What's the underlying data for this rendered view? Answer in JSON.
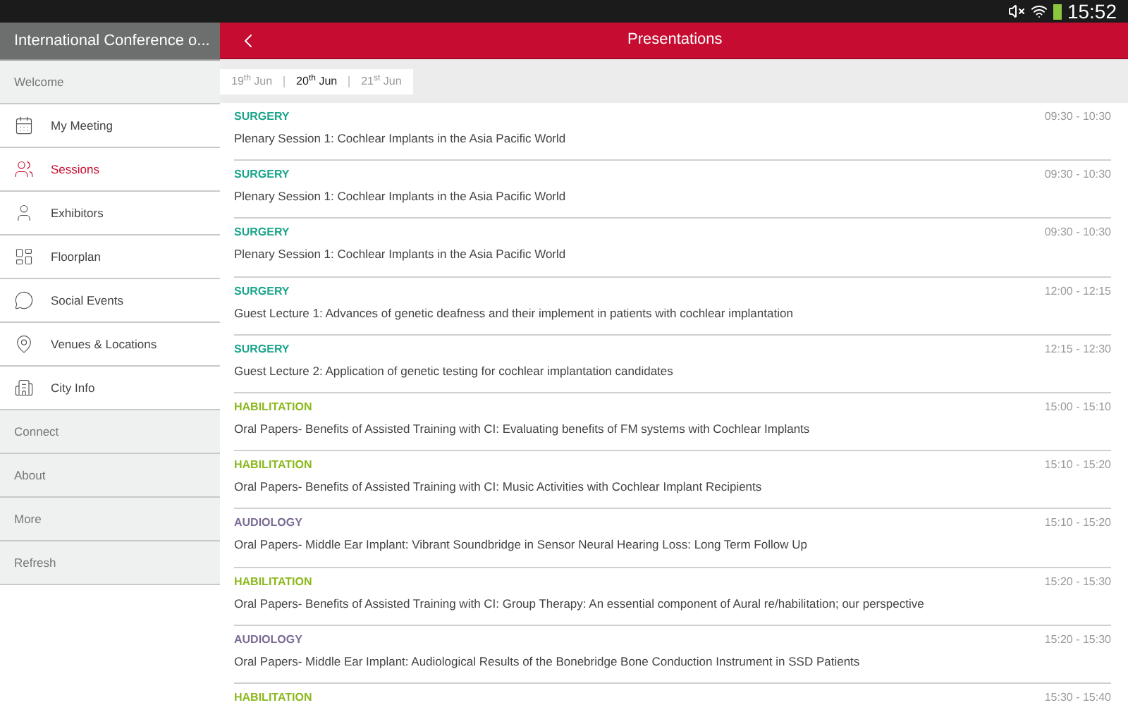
{
  "status_bar": {
    "time": "15:52"
  },
  "sidebar": {
    "title": "International Conference o...",
    "items": [
      {
        "kind": "section",
        "label": "Welcome",
        "selected": false
      },
      {
        "kind": "item",
        "label": "My Meeting",
        "selected": false
      },
      {
        "kind": "item",
        "label": "Sessions",
        "selected": true
      },
      {
        "kind": "item",
        "label": "Exhibitors",
        "selected": false
      },
      {
        "kind": "item",
        "label": "Floorplan",
        "selected": false
      },
      {
        "kind": "item",
        "label": "Social Events",
        "selected": false
      },
      {
        "kind": "item",
        "label": "Venues & Locations",
        "selected": false
      },
      {
        "kind": "item",
        "label": "City Info",
        "selected": false
      },
      {
        "kind": "section",
        "label": "Connect",
        "selected": false
      },
      {
        "kind": "section",
        "label": "About",
        "selected": false
      },
      {
        "kind": "section",
        "label": "More",
        "selected": false
      },
      {
        "kind": "section",
        "label": "Refresh",
        "selected": false
      }
    ]
  },
  "header": {
    "title": "Presentations"
  },
  "date_tabs": [
    {
      "label": "19$^{th}$ Jun",
      "selected": false
    },
    {
      "label": "20$^{th}$ Jun",
      "selected": true
    },
    {
      "label": "21$^{st}$ Jun",
      "selected": false
    }
  ],
  "presentations": [
    {
      "category": "SURGERY",
      "color": "#1aa58a",
      "title": "Plenary Session 1: Cochlear Implants in the Asia Pacific World",
      "time": "09:30 - 10:30"
    },
    {
      "category": "SURGERY",
      "color": "#1aa58a",
      "title": "Plenary Session 1: Cochlear Implants in the Asia Pacific World",
      "time": "09:30 - 10:30"
    },
    {
      "category": "SURGERY",
      "color": "#1aa58a",
      "title": "Plenary Session 1: Cochlear Implants in the Asia Pacific World",
      "time": "09:30 - 10:30"
    },
    {
      "category": "SURGERY",
      "color": "#1aa58a",
      "title": "Guest Lecture 1: Advances of genetic deafness and their implement in patients with cochlear implantation",
      "time": "12:00 - 12:15"
    },
    {
      "category": "SURGERY",
      "color": "#1aa58a",
      "title": "Guest Lecture 2: Application of genetic testing for cochlear implantation candidates",
      "time": "12:15 - 12:30"
    },
    {
      "category": "HABILITATION",
      "color": "#8cb81e",
      "title": "Oral Papers- Benefits of Assisted Training with CI: Evaluating benefits of FM systems with Cochlear Implants",
      "time": "15:00 - 15:10"
    },
    {
      "category": "HABILITATION",
      "color": "#8cb81e",
      "title": "Oral Papers- Benefits of Assisted Training with CI: Music Activities with Cochlear Implant Recipients",
      "time": "15:10 - 15:20"
    },
    {
      "category": "AUDIOLOGY",
      "color": "#7a6b94",
      "title": "Oral Papers- Middle Ear Implant: Vibrant Soundbridge in Sensor Neural Hearing Loss: Long Term Follow Up",
      "time": "15:10 - 15:20"
    },
    {
      "category": "HABILITATION",
      "color": "#8cb81e",
      "title": "Oral Papers- Benefits of Assisted Training with CI: Group Therapy: An essential component of Aural re/habilitation; our perspective",
      "time": "15:20 - 15:30"
    },
    {
      "category": "AUDIOLOGY",
      "color": "#7a6b94",
      "title": "Oral Papers- Middle Ear Implant: Audiological Results of the Bonebridge Bone Conduction Instrument in SSD Patients",
      "time": "15:20 - 15:30"
    },
    {
      "category": "HABILITATION",
      "color": "#8cb81e",
      "time": "15:30 - 15:40"
    }
  ]
}
